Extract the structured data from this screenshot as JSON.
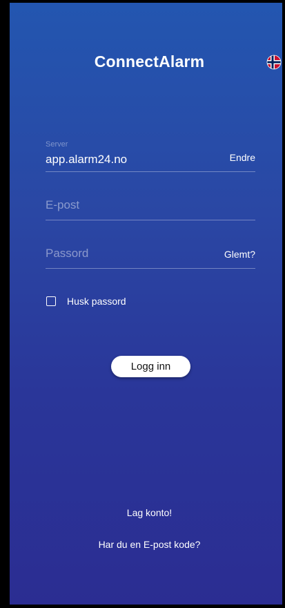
{
  "app": {
    "title": "ConnectAlarm",
    "language_flag": "norway-flag-icon"
  },
  "server": {
    "label": "Server",
    "value": "app.alarm24.no",
    "change_label": "Endre"
  },
  "email": {
    "placeholder": "E-post"
  },
  "password": {
    "placeholder": "Passord",
    "forgot_label": "Glemt?"
  },
  "remember": {
    "label": "Husk passord",
    "checked": false
  },
  "login": {
    "label": "Logg inn"
  },
  "links": {
    "create_account": "Lag konto!",
    "email_code": "Har du en E-post kode?"
  },
  "colors": {
    "background_top": "#2356b0",
    "background_bottom": "#2b2d92",
    "flag_red": "#c8102e",
    "flag_blue": "#00205b"
  }
}
